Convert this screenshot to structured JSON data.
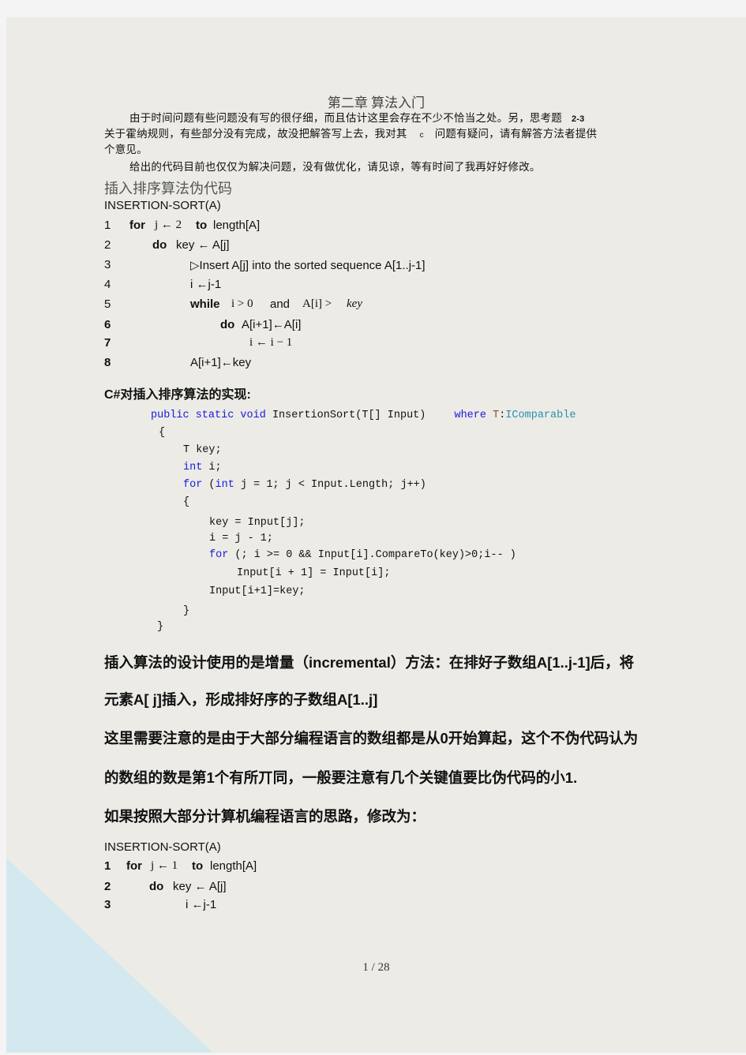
{
  "document": {
    "title": "第二章  算法入门",
    "intro": {
      "line1": "由于时间问题有些问题没有写的很仔细，而且估计这里会存在不少不恰当之处。另，思考题",
      "line1_ref": "2-3",
      "line2a": "关于霍纳规则，有些部分没有完成，故没把解答写上去，我对其",
      "line2_ref": "c",
      "line2b": "问题有疑问，请有解答方法者提供",
      "line3": "个意见。",
      "line4": "给出的代码目前也仅仅为解决问题，没有做优化，请见谅，等有时间了我再好好修改。"
    },
    "pseudocode_heading": "插入排序算法伪代码",
    "pseudocode1": {
      "name": "INSERTION-SORT(A)",
      "lines": [
        {
          "num": "1",
          "kw": "for",
          "a": "j ← 2",
          "kw2": "to",
          "b": "length[A]"
        },
        {
          "num": "2",
          "kw": "do",
          "a": "key ← A[j]"
        },
        {
          "num": "3",
          "a": "▷Insert  A[j]  into  the  sorted  sequence  A[1..j-1]"
        },
        {
          "num": "4",
          "a": "i ←j-1"
        },
        {
          "num": "5",
          "kw": "while",
          "a": "i > 0",
          "b": "and",
          "c": "A[i] >",
          "d": "key"
        },
        {
          "num": "6",
          "kw": "do",
          "a": "A[i+1]←A[i]"
        },
        {
          "num": "7",
          "a": "i ← i − 1"
        },
        {
          "num": "8",
          "a": "A[i+1]←key"
        }
      ]
    },
    "csharp_heading": "C#对插入排序算法的实现:",
    "code": {
      "sig_kw": "public static void",
      "sig_name": "InsertionSort(T[] Input)",
      "sig_where": "where",
      "sig_t": "T",
      "sig_colon": ":",
      "sig_iface": "IComparable",
      "open1": "{",
      "l_key": "T key;",
      "l_int_kw": "int",
      "l_int_rest": " i;",
      "l_for_kw": "for",
      "l_for_p1": " (",
      "l_for_int": "int",
      "l_for_rest": " j = 1; j < Input.Length; j++)",
      "open2": "{",
      "l_assign_key": "key = Input[j];",
      "l_assign_i": "i = j - 1;",
      "l_for2_kw": "for",
      "l_for2_rest": " (; i >= 0 && Input[i].CompareTo(key)>0;i-- )",
      "l_shift": "Input[i + 1] = Input[i];",
      "l_place": "Input[i+1]=key;",
      "close2": "}",
      "close1": "}"
    },
    "para1_line1": "插入算法的设计使用的是增量（incremental）方法：在排好子数组A[1..j-1]后，将",
    "para1_line2": "元素A[ j]插入，形成排好序的子数组A[1..j]",
    "para2_line1": "这里需要注意的是由于大部分编程语言的数组都是从0开始算起，这个不伪代码认为",
    "para2_line2": "的数组的数是第1个有所丌同，一般要注意有几个关键值要比伪代码的小1.",
    "para3": "如果按照大部分计算机编程语言的思路，修改为：",
    "pseudocode2": {
      "name": "INSERTION-SORT(A)",
      "lines": [
        {
          "num": "1",
          "kw": "for",
          "a": "j ← 1",
          "kw2": "to",
          "b": "length[A]"
        },
        {
          "num": "2",
          "kw": "do",
          "a": "key ← A[j]"
        },
        {
          "num": "3",
          "a": "i ←j-1"
        }
      ]
    },
    "page_number": "1 / 28"
  },
  "colors": {
    "background": "#f4f4f4",
    "page": "#ecebe6",
    "corner": "#d3e9ef",
    "code_keyword": "#1a1ae0",
    "code_type": "#2b91af"
  }
}
